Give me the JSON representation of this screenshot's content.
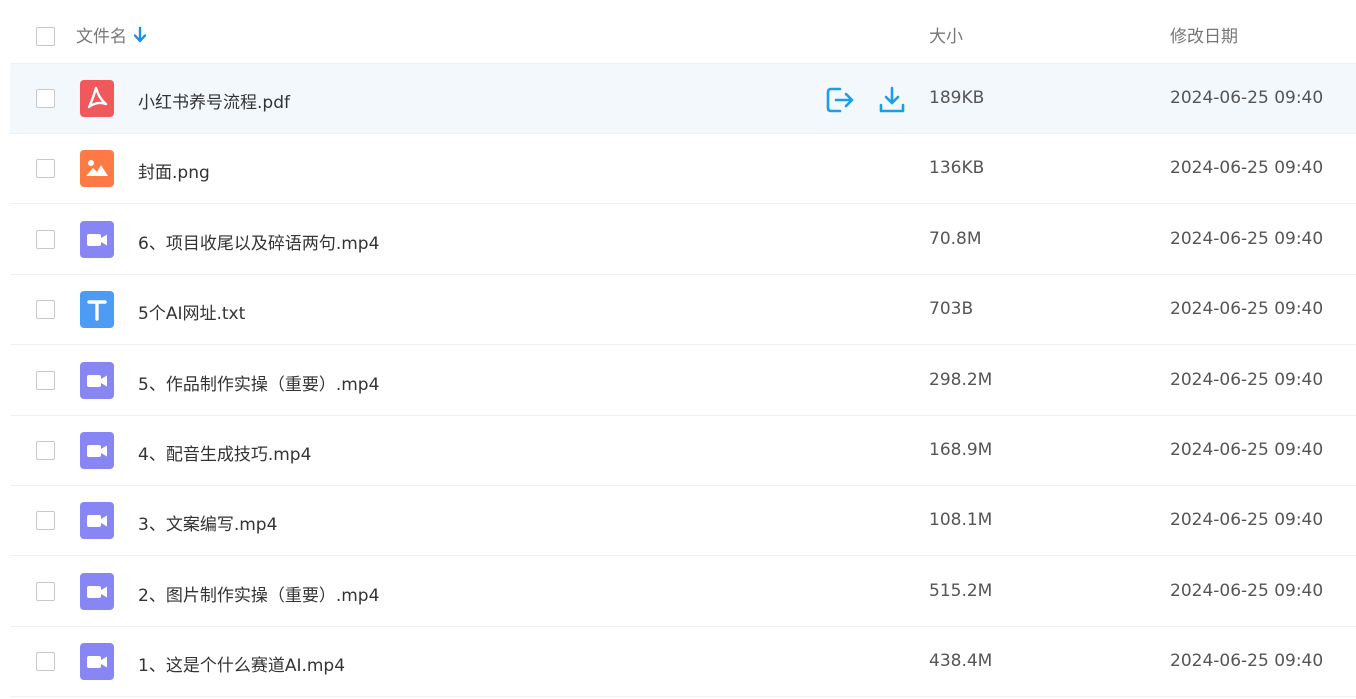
{
  "header": {
    "name_label": "文件名",
    "size_label": "大小",
    "date_label": "修改日期",
    "sort_icon": "arrow-down-icon"
  },
  "colors": {
    "pdf": "#f0595b",
    "image": "#fd7a46",
    "video": "#8886f4",
    "text": "#4c9bf5",
    "action": "#1c9ee6",
    "selected_row": "#f3f8fd"
  },
  "files": [
    {
      "name": "小红书养号流程.pdf",
      "size": "189KB",
      "date": "2024-06-25 09:40",
      "type": "pdf",
      "icon": "pdf-file-icon"
    },
    {
      "name": "封面.png",
      "size": "136KB",
      "date": "2024-06-25 09:40",
      "type": "image",
      "icon": "image-file-icon"
    },
    {
      "name": "6、项目收尾以及碎语两句.mp4",
      "size": "70.8M",
      "date": "2024-06-25 09:40",
      "type": "video",
      "icon": "video-file-icon"
    },
    {
      "name": "5个AI网址.txt",
      "size": "703B",
      "date": "2024-06-25 09:40",
      "type": "text",
      "icon": "text-file-icon"
    },
    {
      "name": "5、作品制作实操（重要）.mp4",
      "size": "298.2M",
      "date": "2024-06-25 09:40",
      "type": "video",
      "icon": "video-file-icon"
    },
    {
      "name": "4、配音生成技巧.mp4",
      "size": "168.9M",
      "date": "2024-06-25 09:40",
      "type": "video",
      "icon": "video-file-icon"
    },
    {
      "name": "3、文案编写.mp4",
      "size": "108.1M",
      "date": "2024-06-25 09:40",
      "type": "video",
      "icon": "video-file-icon"
    },
    {
      "name": "2、图片制作实操（重要）.mp4",
      "size": "515.2M",
      "date": "2024-06-25 09:40",
      "type": "video",
      "icon": "video-file-icon"
    },
    {
      "name": "1、这是个什么赛道AI.mp4",
      "size": "438.4M",
      "date": "2024-06-25 09:40",
      "type": "video",
      "icon": "video-file-icon"
    }
  ],
  "row_actions": {
    "share_icon": "share-icon",
    "download_icon": "download-icon"
  }
}
